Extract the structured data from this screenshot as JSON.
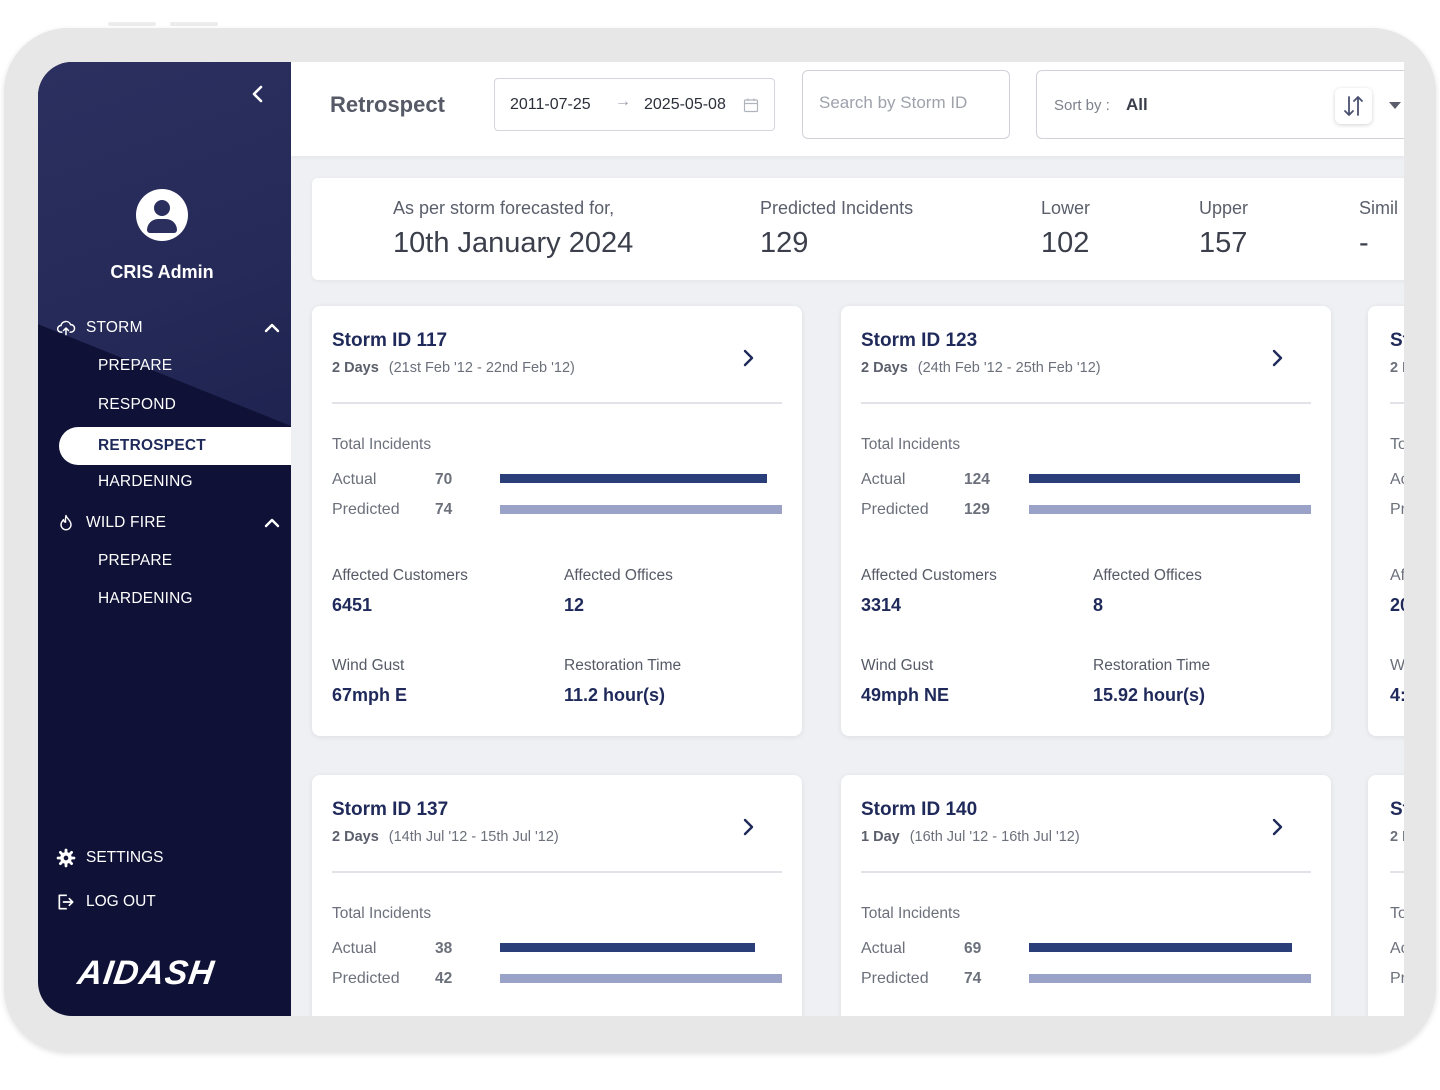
{
  "sidebar": {
    "user_name": "CRIS Admin",
    "groups": [
      {
        "label": "STORM",
        "items": [
          "PREPARE",
          "RESPOND",
          "RETROSPECT",
          "HARDENING"
        ]
      },
      {
        "label": "WILD FIRE",
        "items": [
          "PREPARE",
          "HARDENING"
        ]
      }
    ],
    "active_item": "RETROSPECT",
    "settings_label": "SETTINGS",
    "logout_label": "LOG OUT",
    "logo_text": "AIDASH"
  },
  "header": {
    "title": "Retrospect",
    "date_start": "2011-07-25",
    "date_end": "2025-05-08",
    "search_placeholder": "Search by Storm ID",
    "sort_label": "Sort by :",
    "sort_value": "All"
  },
  "forecast": {
    "caption": "As per storm forecasted for,",
    "date": "10th January 2024",
    "predicted_label": "Predicted Incidents",
    "predicted_value": "129",
    "lower_label": "Lower",
    "lower_value": "102",
    "upper_label": "Upper",
    "upper_value": "157",
    "similar_label": "Simil",
    "similar_value": "-"
  },
  "card_labels": {
    "total_incidents": "Total Incidents",
    "actual": "Actual",
    "predicted": "Predicted",
    "affected_customers": "Affected Customers",
    "affected_offices": "Affected Offices",
    "wind_gust": "Wind Gust",
    "restoration_time": "Restoration Time"
  },
  "bar_colors": {
    "actual": "#2a3f7a",
    "predicted": "#9aa3c7"
  },
  "storms": [
    {
      "title": "Storm ID 117",
      "duration": "2 Days",
      "range": "(21st Feb '12 - 22nd Feb '12)",
      "actual": 70,
      "predicted": 74,
      "customers": "6451",
      "offices": "12",
      "wind": "67mph E",
      "restoration": "11.2 hour(s)"
    },
    {
      "title": "Storm ID 123",
      "duration": "2 Days",
      "range": "(24th Feb '12 - 25th Feb '12)",
      "actual": 124,
      "predicted": 129,
      "customers": "3314",
      "offices": "8",
      "wind": "49mph NE",
      "restoration": "15.92 hour(s)"
    },
    {
      "title": "Storm ID 137",
      "duration": "2 Days",
      "range": "(14th Jul '12 - 15th Jul '12)",
      "actual": 38,
      "predicted": 42
    },
    {
      "title": "Storm ID 140",
      "duration": "1 Day",
      "range": "(16th Jul '12 - 16th Jul '12)",
      "actual": 69,
      "predicted": 74
    }
  ],
  "partial_cards": [
    {
      "title": "St",
      "duration": "2 I",
      "total": "To",
      "actual": "Ac",
      "predicted": "Pr",
      "customers_label": "Af",
      "customers_value": "20",
      "wind_label": "W",
      "wind_value": "4:"
    },
    {
      "title": "St",
      "duration": "2 I",
      "total": "To",
      "actual": "Ac",
      "predicted": "Pr"
    }
  ]
}
